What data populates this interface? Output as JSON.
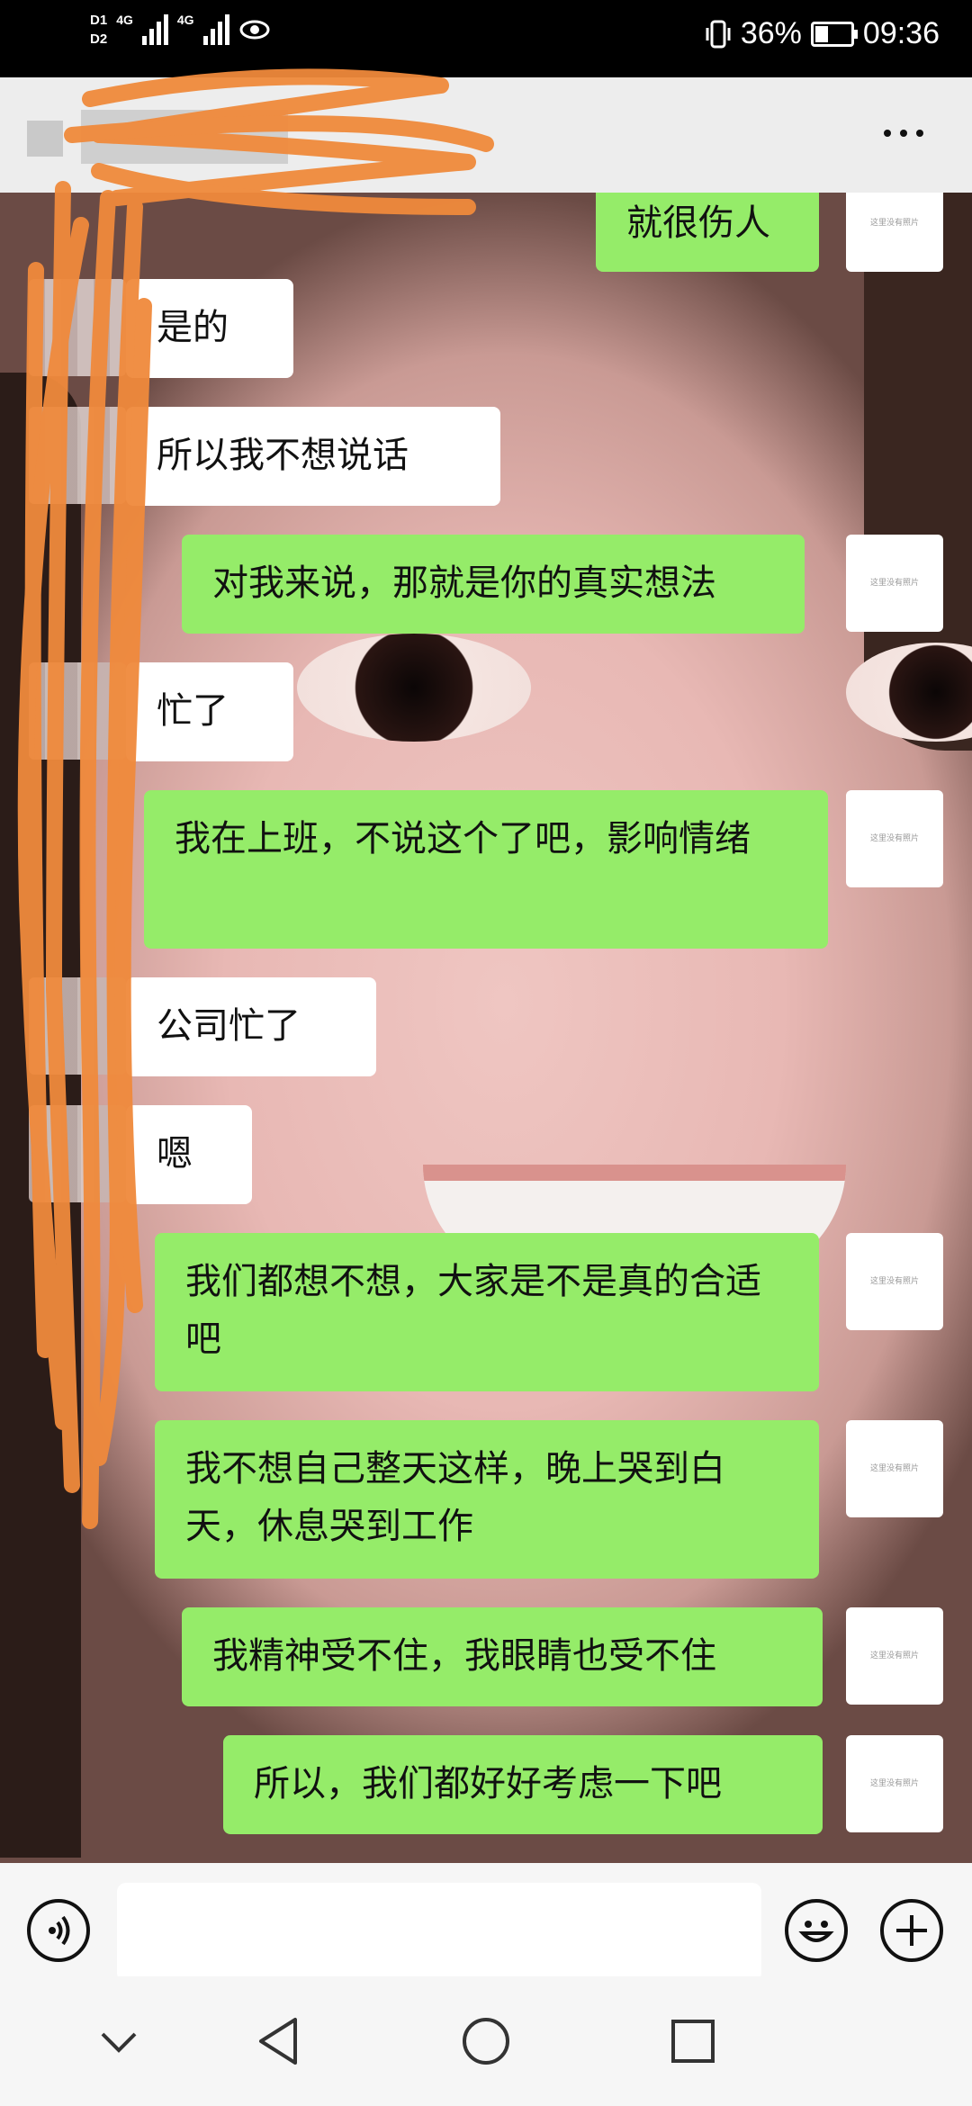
{
  "statusbar": {
    "sim1": "D1",
    "sim2": "D2",
    "network1": "4G",
    "network2": "4G",
    "battery_percent": "36%",
    "time": "09:36",
    "battery_level": 0.36
  },
  "chat": {
    "avatar_caption": "这里没有照片",
    "messages": [
      {
        "side": "right",
        "text": "就很伤人"
      },
      {
        "side": "left",
        "text": "是的"
      },
      {
        "side": "left",
        "text": "所以我不想说话"
      },
      {
        "side": "right",
        "text": "对我来说，那就是你的真实想法"
      },
      {
        "side": "left",
        "text": "忙了"
      },
      {
        "side": "right",
        "text": "我在上班，不说这个了吧，影响情绪"
      },
      {
        "side": "left",
        "text": "公司忙了"
      },
      {
        "side": "left",
        "text": "嗯"
      },
      {
        "side": "right",
        "text": "我们都想不想，大家是不是真的合适吧"
      },
      {
        "side": "right",
        "text": "我不想自己整天这样，晚上哭到白天，休息哭到工作"
      },
      {
        "side": "right",
        "text": "我精神受不住，我眼睛也受不住"
      },
      {
        "side": "right",
        "text": "所以，我们都好好考虑一下吧"
      }
    ]
  },
  "input": {
    "placeholder": ""
  },
  "icons": {
    "voice": "voice-icon",
    "emoji": "emoji-icon",
    "plus": "plus-icon",
    "menu": "more-icon"
  },
  "colors": {
    "sent_bubble": "#95ec69",
    "received_bubble": "#ffffff",
    "scribble": "#f08a3c"
  }
}
